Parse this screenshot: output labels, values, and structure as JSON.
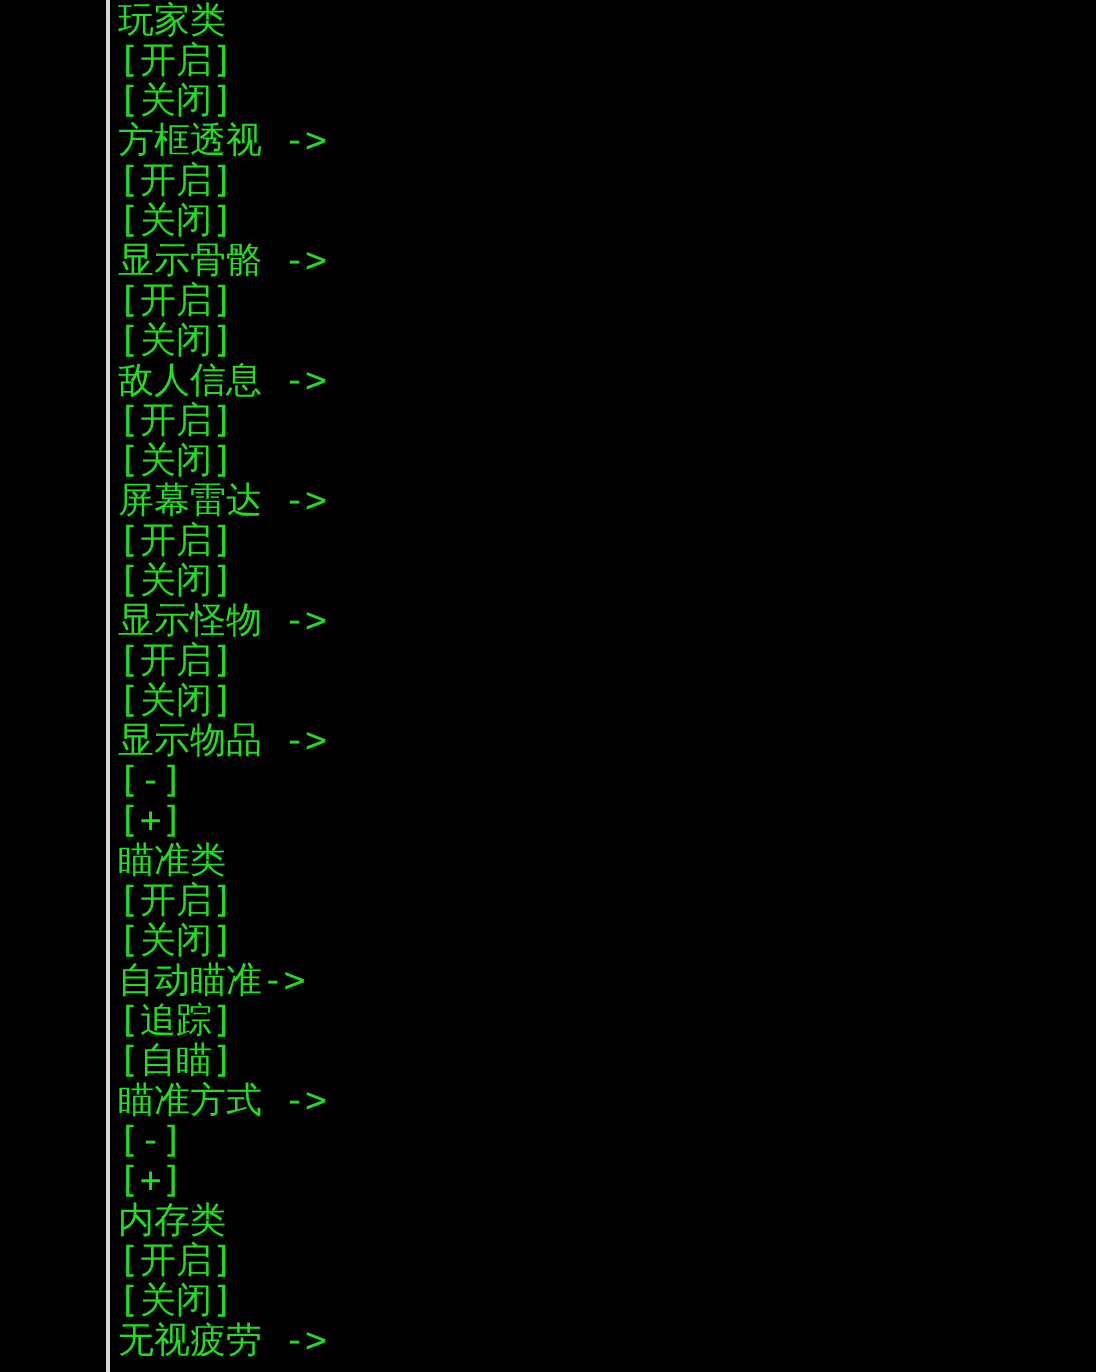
{
  "lines": [
    "玩家类",
    "[开启]",
    "[关闭]",
    "方框透视 ->",
    "[开启]",
    "[关闭]",
    "显示骨骼 ->",
    "[开启]",
    "[关闭]",
    "敌人信息 ->",
    "[开启]",
    "[关闭]",
    "屏幕雷达 ->",
    "[开启]",
    "[关闭]",
    "显示怪物 ->",
    "[开启]",
    "[关闭]",
    "显示物品 ->",
    "[-]",
    "[+]",
    "瞄准类",
    "[开启]",
    "[关闭]",
    "自动瞄准->",
    "[追踪]",
    "[自瞄]",
    "瞄准方式 ->",
    "[-]",
    "[+]",
    "内存类",
    "[开启]",
    "[关闭]",
    "无视疲劳 ->"
  ]
}
